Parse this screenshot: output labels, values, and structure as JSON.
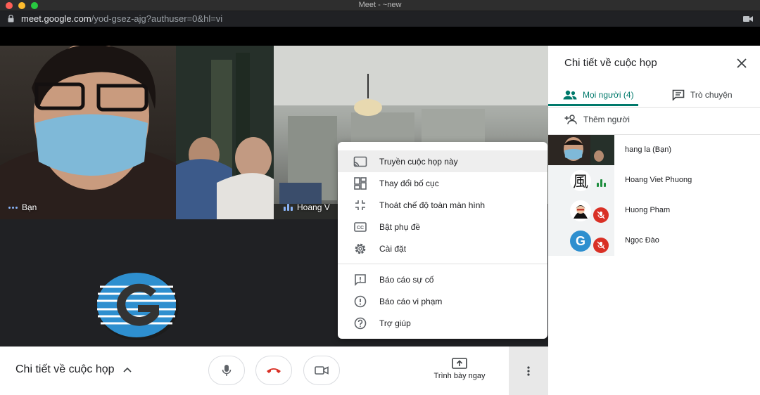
{
  "window": {
    "title": "Meet - ~new"
  },
  "address": {
    "host": "meet.google.com",
    "path": "/yod-gsez-ajg?authuser=0&hl=vi"
  },
  "tiles": {
    "you_label": "Bạn",
    "hv_label": "Hoang V"
  },
  "menu": {
    "items": [
      {
        "label": "Truyền cuộc họp này",
        "icon": "cast-icon"
      },
      {
        "label": "Thay đổi bố cục",
        "icon": "layout-icon"
      },
      {
        "label": "Thoát chế độ toàn màn hình",
        "icon": "exit-fullscreen-icon"
      },
      {
        "label": "Bật phụ đề",
        "icon": "captions-icon"
      },
      {
        "label": "Cài đặt",
        "icon": "gear-icon"
      },
      {
        "label": "Báo cáo sự cố",
        "icon": "feedback-icon"
      },
      {
        "label": "Báo cáo vi phạm",
        "icon": "report-icon"
      },
      {
        "label": "Trợ giúp",
        "icon": "help-icon"
      }
    ]
  },
  "bottom": {
    "meeting_details": "Chi tiết về cuộc họp",
    "present_label": "Trình bày ngay"
  },
  "panel": {
    "title": "Chi tiết về cuộc họp",
    "tab_people": "Mọi người (4)",
    "tab_chat": "Trò chuyện",
    "add_people": "Thêm người",
    "participants": [
      {
        "name": "hang la (Bạn)",
        "status": "video"
      },
      {
        "name": "Hoang Viet Phuong",
        "status": "speaking",
        "avatar_text": "風"
      },
      {
        "name": "Huong Pham",
        "status": "muted"
      },
      {
        "name": "Ngọc Đào",
        "status": "muted",
        "avatar_text": "G"
      }
    ]
  },
  "colors": {
    "accent": "#00796b",
    "hangup": "#d93025",
    "speaking": "#1e8e3e"
  }
}
